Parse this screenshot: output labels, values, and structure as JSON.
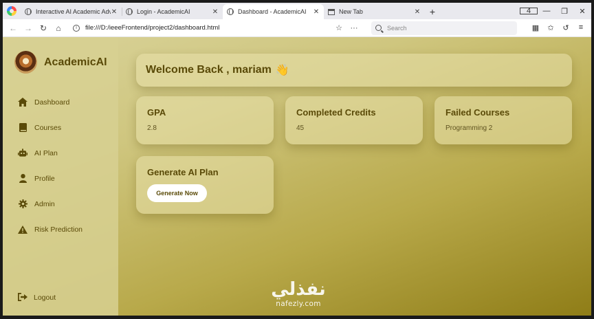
{
  "browser": {
    "tabs": [
      {
        "title": "Interactive AI Academic Advi",
        "icon": "globe-icon",
        "active": false
      },
      {
        "title": "Login - AcademicAI",
        "icon": "globe-icon",
        "active": false
      },
      {
        "title": "Dashboard - AcademicAI",
        "icon": "globe-icon",
        "active": true
      },
      {
        "title": "New Tab",
        "icon": "page-icon",
        "active": false
      }
    ],
    "tab_count": "4",
    "url": "file:///D:/ieeeFrontend/project2/dashboard.html",
    "search_placeholder": "Search"
  },
  "sidebar": {
    "brand": "AcademicAI",
    "items": [
      {
        "label": "Dashboard",
        "icon": "home-icon"
      },
      {
        "label": "Courses",
        "icon": "book-icon"
      },
      {
        "label": "AI Plan",
        "icon": "robot-icon"
      },
      {
        "label": "Profile",
        "icon": "user-icon"
      },
      {
        "label": "Admin",
        "icon": "gear-icon"
      },
      {
        "label": "Risk Prediction",
        "icon": "warning-icon"
      }
    ],
    "logout": "Logout"
  },
  "main": {
    "welcome": "Welcome Back , mariam",
    "welcome_emoji": "👋",
    "stats": [
      {
        "label": "GPA",
        "value": "2.8"
      },
      {
        "label": "Completed Credits",
        "value": "45"
      },
      {
        "label": "Failed Courses",
        "value": "Programming 2"
      }
    ],
    "plan": {
      "label": "Generate AI Plan",
      "button": "Generate Now"
    }
  },
  "watermark": {
    "arabic": "نفذلي",
    "latin": "nafezly.com"
  },
  "colors": {
    "accent": "#5a4a08",
    "page_start": "#d9d39a",
    "page_end": "#8f7d17"
  }
}
